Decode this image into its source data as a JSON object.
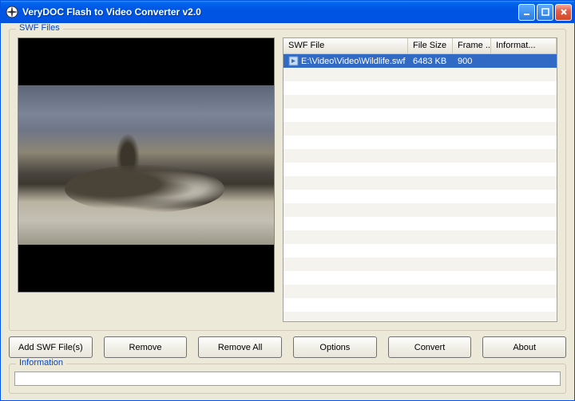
{
  "window": {
    "title": "VeryDOC Flash to Video Converter v2.0"
  },
  "groups": {
    "swf_legend": "SWF Files",
    "info_legend": "Information"
  },
  "table": {
    "headers": {
      "file": "SWF File",
      "size": "File Size",
      "frame": "Frame ...",
      "info": "Informat..."
    },
    "rows": [
      {
        "file": "E:\\Video\\Video\\Wildlife.swf",
        "size": "6483 KB",
        "frame": "900",
        "info": ""
      }
    ]
  },
  "buttons": {
    "add": "Add SWF File(s)",
    "remove": "Remove",
    "removeAll": "Remove All",
    "options": "Options",
    "convert": "Convert",
    "about": "About"
  },
  "status": {
    "text": ""
  }
}
